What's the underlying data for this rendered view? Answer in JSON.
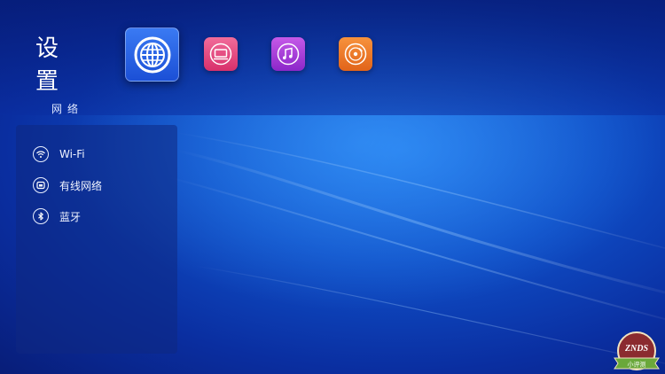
{
  "header": {
    "title": "设 置",
    "subtitle": "网络"
  },
  "apps": [
    {
      "name": "network",
      "icon": "globe-icon",
      "color": "#2563e6",
      "selected": true
    },
    {
      "name": "display",
      "icon": "monitor-icon",
      "color": "#e8467f"
    },
    {
      "name": "music",
      "icon": "music-note-icon",
      "color": "#a83fd8"
    },
    {
      "name": "media",
      "icon": "disc-icon",
      "color": "#ef7a2a"
    }
  ],
  "menu": {
    "items": [
      {
        "label": "Wi-Fi",
        "icon": "wifi-icon"
      },
      {
        "label": "有线网络",
        "icon": "ethernet-icon"
      },
      {
        "label": "蓝牙",
        "icon": "bluetooth-icon"
      }
    ]
  },
  "badge": {
    "text": "ZNDS",
    "banner": "小评测"
  },
  "colors": {
    "background": "#0f4fc8",
    "panel": "#0e2882",
    "accent": "#2563e6"
  }
}
